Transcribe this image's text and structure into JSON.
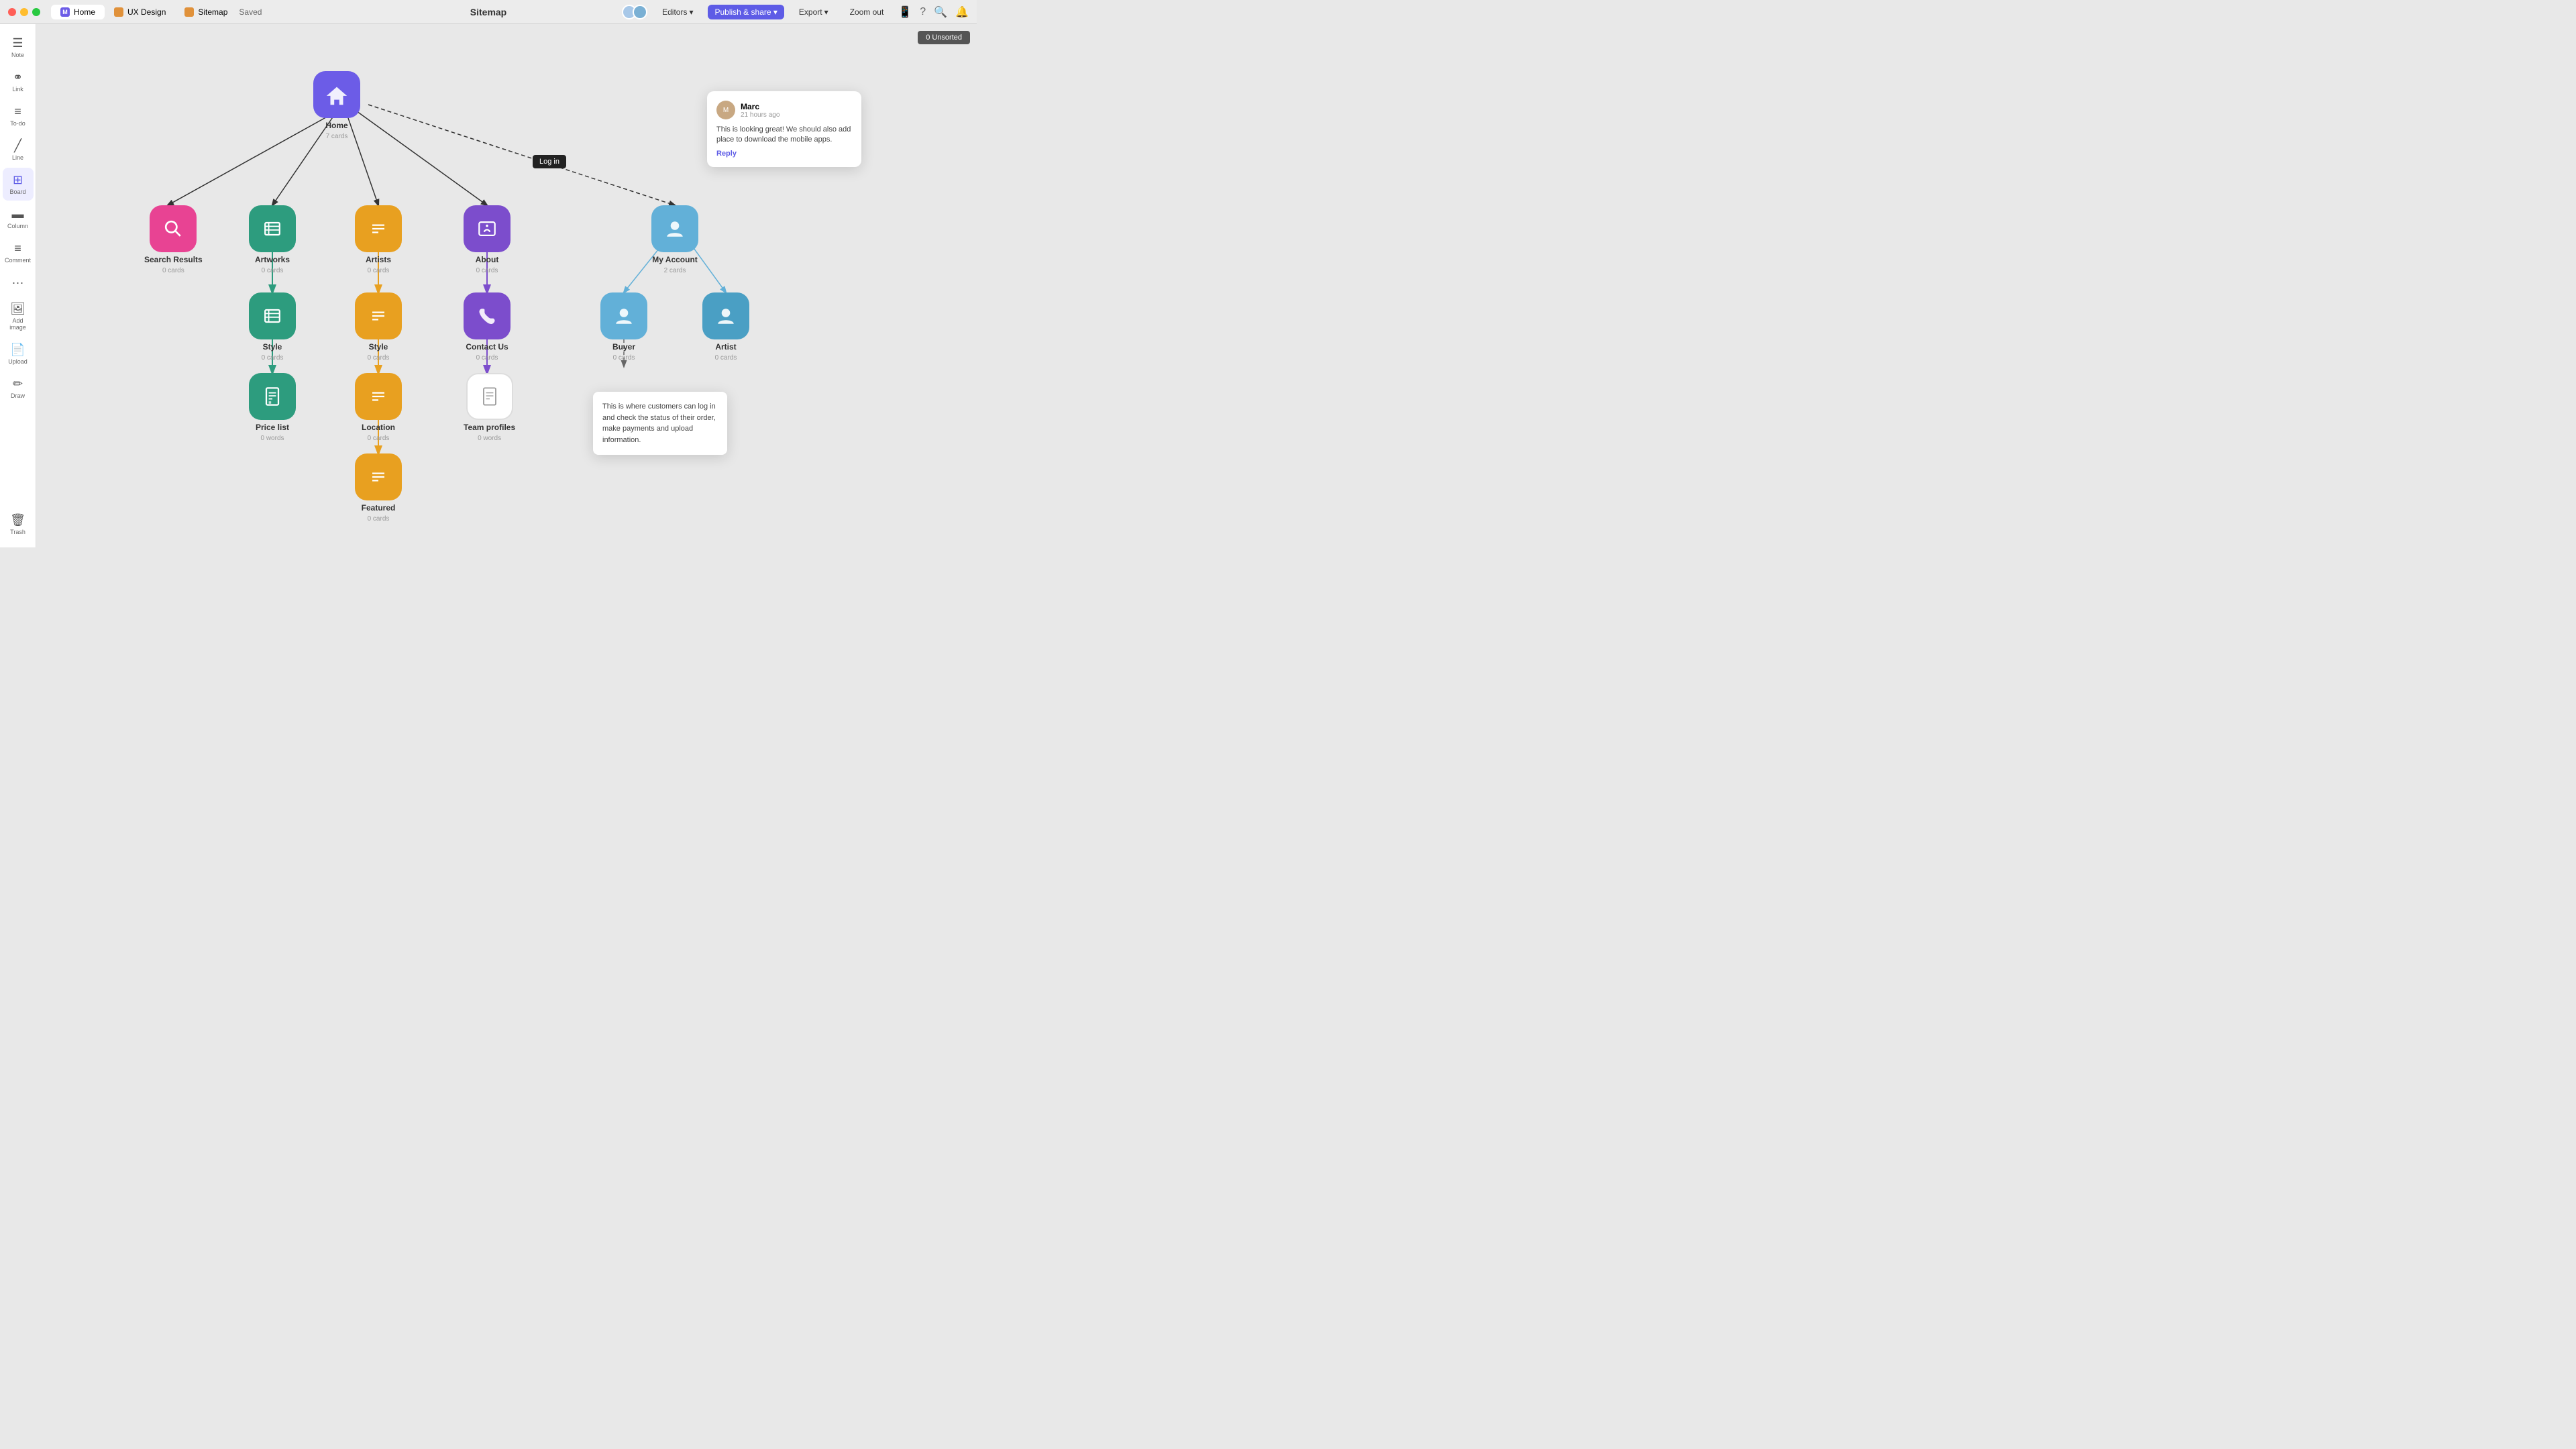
{
  "titlebar": {
    "traffic_lights": [
      "red",
      "yellow",
      "green"
    ],
    "tabs": [
      {
        "label": "Home",
        "icon_type": "m",
        "active": true
      },
      {
        "label": "UX Design",
        "icon_type": "ux"
      },
      {
        "label": "Sitemap",
        "icon_type": "sm"
      }
    ],
    "saved_label": "Saved",
    "title": "Sitemap",
    "editors_label": "Editors",
    "publish_label": "Publish & share",
    "export_label": "Export",
    "zoom_label": "Zoom out"
  },
  "toolbar": {
    "items": [
      {
        "label": "Note",
        "icon": "☰",
        "active": false
      },
      {
        "label": "Link",
        "icon": "🔗",
        "active": false
      },
      {
        "label": "To-do",
        "icon": "≡",
        "active": false
      },
      {
        "label": "Line",
        "icon": "╱",
        "active": false
      },
      {
        "label": "Board",
        "icon": "⊞",
        "active": true
      },
      {
        "label": "Column",
        "icon": "▭",
        "active": false
      },
      {
        "label": "Comment",
        "icon": "≡",
        "active": false
      },
      {
        "label": "···",
        "icon": "···",
        "active": false
      },
      {
        "label": "Add image",
        "icon": "🖼",
        "active": false
      },
      {
        "label": "Upload",
        "icon": "📄",
        "active": false
      },
      {
        "label": "Draw",
        "icon": "✏",
        "active": false
      }
    ],
    "trash_label": "Trash"
  },
  "unsorted": "0 Unsorted",
  "nodes": {
    "home": {
      "label": "Home",
      "sub": "7 cards",
      "color": "purple"
    },
    "search_results": {
      "label": "Search Results",
      "sub": "0 cards",
      "color": "pink"
    },
    "artworks": {
      "label": "Artworks",
      "sub": "0 cards",
      "color": "teal"
    },
    "artists": {
      "label": "Artists",
      "sub": "0 cards",
      "color": "orange"
    },
    "about": {
      "label": "About",
      "sub": "0 cards",
      "color": "violet"
    },
    "my_account": {
      "label": "My Account",
      "sub": "2 cards",
      "color": "blue_light"
    },
    "style_1": {
      "label": "Style",
      "sub": "0 cards",
      "color": "teal"
    },
    "style_2": {
      "label": "Style",
      "sub": "0 cards",
      "color": "orange"
    },
    "contact_us": {
      "label": "Contact Us",
      "sub": "0 cards",
      "color": "violet"
    },
    "buyer": {
      "label": "Buyer",
      "sub": "0 cards",
      "color": "blue_light"
    },
    "artist": {
      "label": "Artist",
      "sub": "0 cards",
      "color": "blue_light"
    },
    "price_list": {
      "label": "Price list",
      "sub": "0 words",
      "color": "teal"
    },
    "location": {
      "label": "Location",
      "sub": "0 cards",
      "color": "orange"
    },
    "team_profiles": {
      "label": "Team profiles",
      "sub": "0 words",
      "color": "white"
    },
    "featured": {
      "label": "Featured",
      "sub": "0 cards",
      "color": "orange"
    }
  },
  "comment": {
    "author": "Marc",
    "time": "21 hours ago",
    "text": "This is looking great! We should also add place to download the mobile apps.",
    "reply_label": "Reply"
  },
  "tooltip": {
    "text": "This is where customers can log in and check the status of their order, make payments and upload information."
  },
  "login_badge": "Log in"
}
